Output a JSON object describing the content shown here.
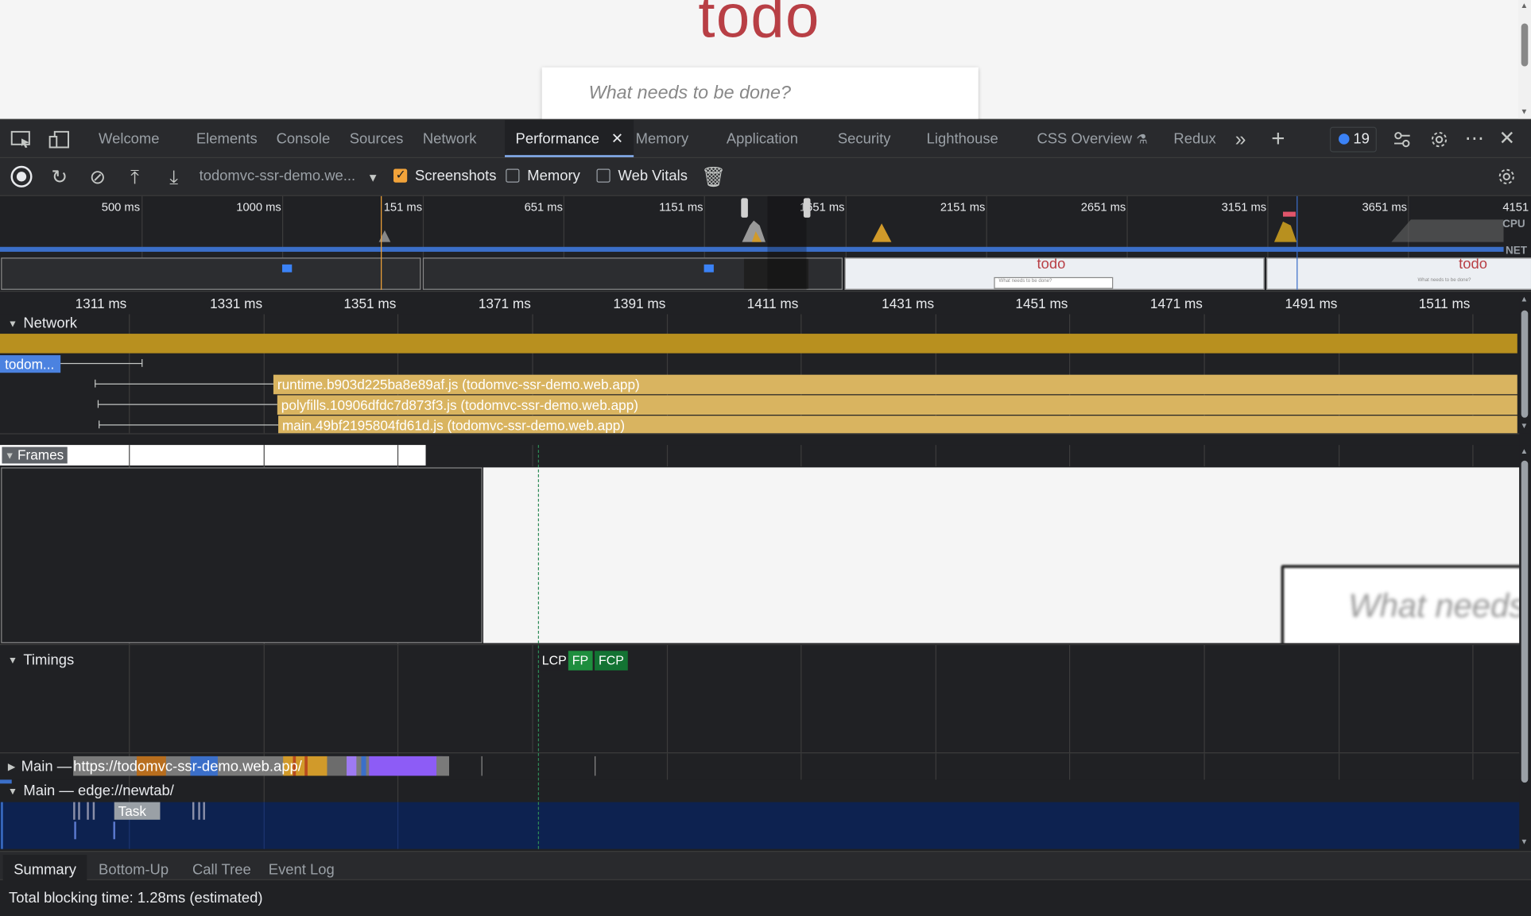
{
  "page": {
    "title": "todo",
    "input_placeholder": "What needs to be done?"
  },
  "tabs": [
    "Welcome",
    "Elements",
    "Console",
    "Sources",
    "Network",
    "Performance",
    "Memory",
    "Application",
    "Security",
    "Lighthouse",
    "CSS Overview",
    "Redux"
  ],
  "active_tab": "Performance",
  "issues_count": "19",
  "toolbar": {
    "target": "todomvc-ssr-demo.we...",
    "screenshots_label": "Screenshots",
    "screenshots_checked": true,
    "memory_label": "Memory",
    "memory_checked": false,
    "web_vitals_label": "Web Vitals",
    "web_vitals_checked": false
  },
  "overview": {
    "ticks": [
      "500 ms",
      "1000 ms",
      "151 ms",
      "651 ms",
      "1151 ms",
      "1651 ms",
      "2151 ms",
      "2651 ms",
      "3151 ms",
      "3651 ms",
      "4151"
    ],
    "cpu_label": "CPU",
    "net_label": "NET",
    "shot_titles": [
      "todo",
      "todo"
    ],
    "shot_inputs": [
      "What needs to be done?",
      "What needs to be done?"
    ]
  },
  "ruler": {
    "ticks": [
      "1311 ms",
      "1331 ms",
      "1351 ms",
      "1371 ms",
      "1391 ms",
      "1411 ms",
      "1431 ms",
      "1451 ms",
      "1471 ms",
      "1491 ms",
      "1511 ms"
    ]
  },
  "network": {
    "title": "Network",
    "document": "todom...",
    "requests": [
      "runtime.b903d225ba8e89af.js (todomvc-ssr-demo.web.app)",
      "polyfills.10906dfdc7d873f3.js (todomvc-ssr-demo.web.app)",
      "main.49bf2195804fd61d.js (todomvc-ssr-demo.web.app)"
    ],
    "more": "..."
  },
  "frames": {
    "title": "Frames",
    "preview_text": "What needs t"
  },
  "timings": {
    "title": "Timings",
    "markers": [
      "LCP",
      "FP",
      "FCP"
    ],
    "colors": {
      "lcp": "#202124",
      "fp": "#1e8e3e",
      "fcp": "#137333"
    }
  },
  "main_threads": [
    {
      "label": "Main — ",
      "url": "https://todomvc-ssr-demo.web.app/"
    },
    {
      "label": "Main — edge://newtab/",
      "task": "Task"
    }
  ],
  "bottom_tabs": [
    "Summary",
    "Bottom-Up",
    "Call Tree",
    "Event Log"
  ],
  "summary_text": "Total blocking time: 1.28ms (estimated)"
}
